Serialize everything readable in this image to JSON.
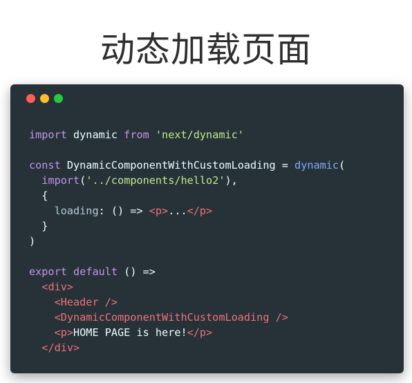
{
  "title": "动态加载页面",
  "window": {
    "dots": [
      {
        "name": "close",
        "color": "#ff5f56"
      },
      {
        "name": "minimize",
        "color": "#ffbd2e"
      },
      {
        "name": "maximize",
        "color": "#27c93f"
      }
    ]
  },
  "code": {
    "lines": [
      [
        {
          "t": "import",
          "c": "kw"
        },
        {
          "t": " dynamic ",
          "c": "plain"
        },
        {
          "t": "from",
          "c": "kw"
        },
        {
          "t": " ",
          "c": "plain"
        },
        {
          "t": "'next/dynamic'",
          "c": "str"
        }
      ],
      [],
      [
        {
          "t": "const",
          "c": "kw"
        },
        {
          "t": " DynamicComponentWithCustomLoading = ",
          "c": "plain"
        },
        {
          "t": "dynamic",
          "c": "fn"
        },
        {
          "t": "(",
          "c": "plain"
        }
      ],
      [
        {
          "t": "  ",
          "c": "plain"
        },
        {
          "t": "import",
          "c": "kw"
        },
        {
          "t": "(",
          "c": "plain"
        },
        {
          "t": "'../components/hello2'",
          "c": "str"
        },
        {
          "t": "),",
          "c": "plain"
        }
      ],
      [
        {
          "t": "  {",
          "c": "plain"
        }
      ],
      [
        {
          "t": "    ",
          "c": "plain"
        },
        {
          "t": "loading",
          "c": "prop"
        },
        {
          "t": ": () => ",
          "c": "plain"
        },
        {
          "t": "<p>",
          "c": "tag"
        },
        {
          "t": "...",
          "c": "plain"
        },
        {
          "t": "</p>",
          "c": "tag"
        }
      ],
      [
        {
          "t": "  }",
          "c": "plain"
        }
      ],
      [
        {
          "t": ")",
          "c": "plain"
        }
      ],
      [],
      [
        {
          "t": "export",
          "c": "kw"
        },
        {
          "t": " ",
          "c": "plain"
        },
        {
          "t": "default",
          "c": "kw"
        },
        {
          "t": " () =>",
          "c": "plain"
        }
      ],
      [
        {
          "t": "  ",
          "c": "plain"
        },
        {
          "t": "<div>",
          "c": "tag"
        }
      ],
      [
        {
          "t": "    ",
          "c": "plain"
        },
        {
          "t": "<Header />",
          "c": "tag"
        }
      ],
      [
        {
          "t": "    ",
          "c": "plain"
        },
        {
          "t": "<DynamicComponentWithCustomLoading />",
          "c": "tag"
        }
      ],
      [
        {
          "t": "    ",
          "c": "plain"
        },
        {
          "t": "<p>",
          "c": "tag"
        },
        {
          "t": "HOME PAGE is here!",
          "c": "plain"
        },
        {
          "t": "</p>",
          "c": "tag"
        }
      ],
      [
        {
          "t": "  ",
          "c": "plain"
        },
        {
          "t": "</div>",
          "c": "tag"
        }
      ]
    ]
  }
}
